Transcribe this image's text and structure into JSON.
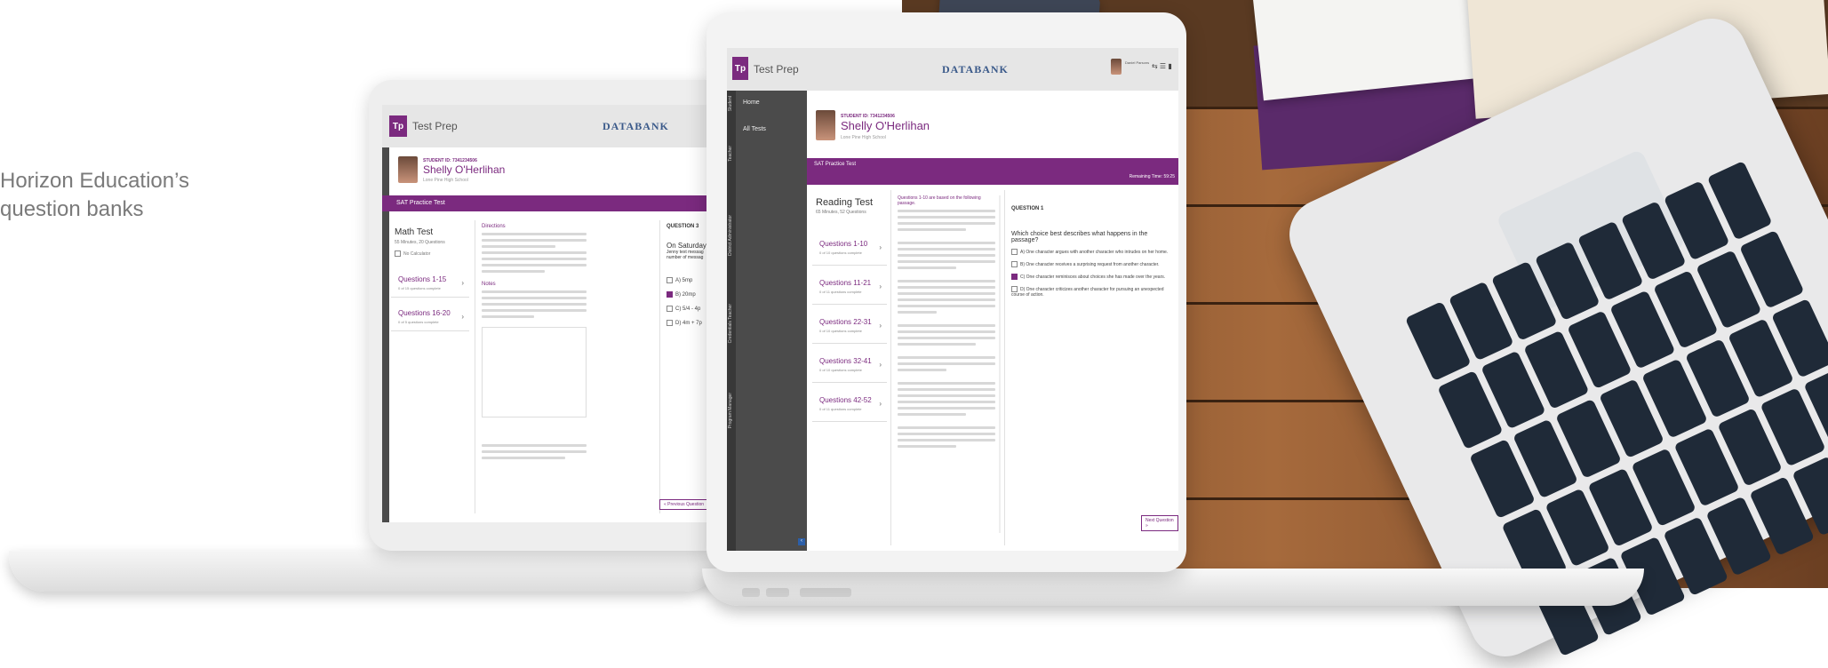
{
  "tagline": {
    "line1": "Horizon Education’s",
    "line2": "question banks"
  },
  "app": {
    "logo_text": "Tp",
    "name": "Test Prep",
    "brand": "DATABANK"
  },
  "student": {
    "id_label": "STUDENT ID: 7341234506",
    "name": "Shelly O'Herlihan",
    "school": "Lone Pine High School"
  },
  "back_screen": {
    "bar_title": "SAT Practice Test",
    "test_title": "Math Test",
    "test_meta": "55 Minutes, 20 Questions",
    "calculator": "No Calculator",
    "sections": [
      {
        "title": "Questions 1-15",
        "sub": "0 of 15 questions complete"
      },
      {
        "title": "Questions 16-20",
        "sub": "0 of 5 questions complete"
      }
    ],
    "directions_title": "Directions",
    "notes_title": "Notes",
    "question_header": "QUESTION 3",
    "question_text": "On Saturday after",
    "question_text2": "Jenny text messag",
    "question_text3": "number of messag",
    "answers": [
      "A) 5mp",
      "B) 20mp",
      "C) 5/4 - 4p",
      "D) 4m + 7p"
    ],
    "selected_answer": 1,
    "prev_button": "« Previous Question"
  },
  "front_screen": {
    "nav": [
      "Home",
      "All Tests"
    ],
    "vertical_tabs": [
      "Student",
      "Teacher",
      "District Administrator",
      "Credentials Teacher",
      "Program Manager"
    ],
    "user_name": "Daniel Parsons",
    "bar_title": "SAT Practice Test",
    "remaining_time": "Remaining Time: 59:25",
    "test_title": "Reading Test",
    "test_meta": "65 Minutes, 52 Questions",
    "passage_header": "Questions 1-10 are based on the following passage.",
    "sections": [
      {
        "title": "Questions 1-10",
        "sub": "0 of 10 questions complete"
      },
      {
        "title": "Questions 11-21",
        "sub": "0 of 11 questions complete"
      },
      {
        "title": "Questions 22-31",
        "sub": "0 of 10 questions complete"
      },
      {
        "title": "Questions 32-41",
        "sub": "0 of 10 questions complete"
      },
      {
        "title": "Questions 42-52",
        "sub": "0 of 11 questions complete"
      }
    ],
    "question_header": "QUESTION 1",
    "question_text": "Which choice best describes what happens in the passage?",
    "answers": [
      "A) One character argues with another character who intrudes on her home.",
      "B) One character receives a surprising request from another character.",
      "C) One character reminisces about choices she has made over the years.",
      "D) One character criticizes another character for pursuing an unexpected course of action."
    ],
    "selected_answer": 2,
    "next_button": "Next Question »"
  }
}
